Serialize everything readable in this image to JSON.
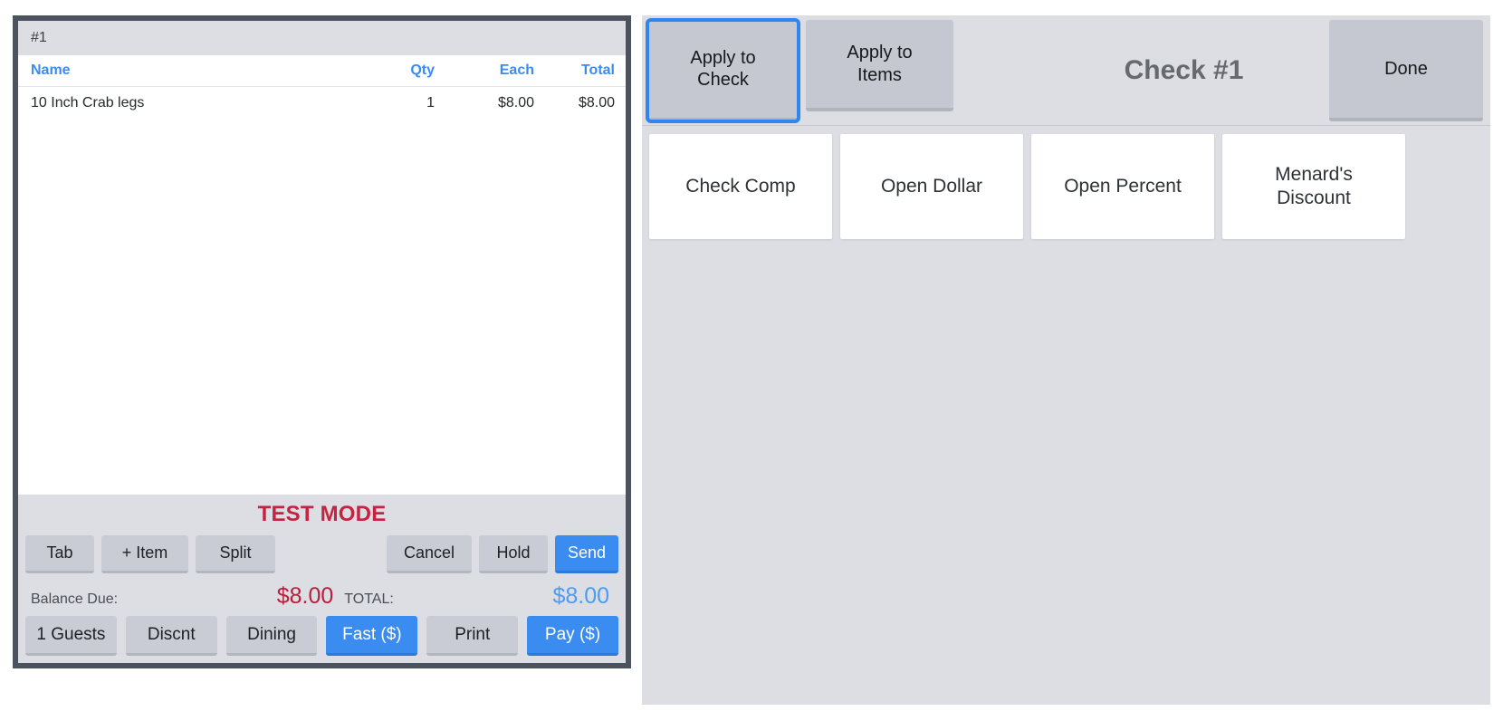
{
  "left_panel": {
    "tab": {
      "label": "#1"
    },
    "table": {
      "columns": [
        {
          "key": "name",
          "label": "Name"
        },
        {
          "key": "qty",
          "label": "Qty"
        },
        {
          "key": "each",
          "label": "Each"
        },
        {
          "key": "total",
          "label": "Total"
        }
      ],
      "rows": [
        {
          "name": "10 Inch Crab legs",
          "qty": "1",
          "each": "$8.00",
          "total": "$8.00"
        }
      ]
    },
    "status_banner": "TEST MODE",
    "actions_top": [
      {
        "label": "Tab",
        "style": "gray"
      },
      {
        "label": "+ Item",
        "style": "gray"
      },
      {
        "label": "Split",
        "style": "gray"
      },
      {
        "label": "Cancel",
        "style": "gray"
      },
      {
        "label": "Hold",
        "style": "gray"
      },
      {
        "label": "Send",
        "style": "blue"
      }
    ],
    "totals": {
      "balance_label": "Balance Due:",
      "balance_value": "$8.00",
      "total_label": "TOTAL:",
      "total_value": "$8.00"
    },
    "actions_bottom": [
      {
        "label": "1 Guests",
        "style": "gray"
      },
      {
        "label": "Discnt",
        "style": "gray"
      },
      {
        "label": "Dining",
        "style": "gray"
      },
      {
        "label": "Fast ($)",
        "style": "blue"
      },
      {
        "label": "Print",
        "style": "gray"
      },
      {
        "label": "Pay ($)",
        "style": "blue"
      }
    ]
  },
  "right_panel": {
    "toolbar": {
      "apply_to_check": "Apply to\nCheck",
      "apply_to_items": "Apply to\nItems",
      "title": "Check #1",
      "done": "Done"
    },
    "discount_tiles": [
      {
        "label": "Check Comp"
      },
      {
        "label": "Open Dollar"
      },
      {
        "label": "Open Percent"
      },
      {
        "label": "Menard's\nDiscount"
      }
    ]
  },
  "colors": {
    "accent_blue": "#3b8cf0",
    "selected_outline": "#2f86f0",
    "balance_red": "#b5213b",
    "test_mode_red": "#c62343",
    "panel_gray": "#dcdee3",
    "frame_dark": "#4c525e"
  }
}
